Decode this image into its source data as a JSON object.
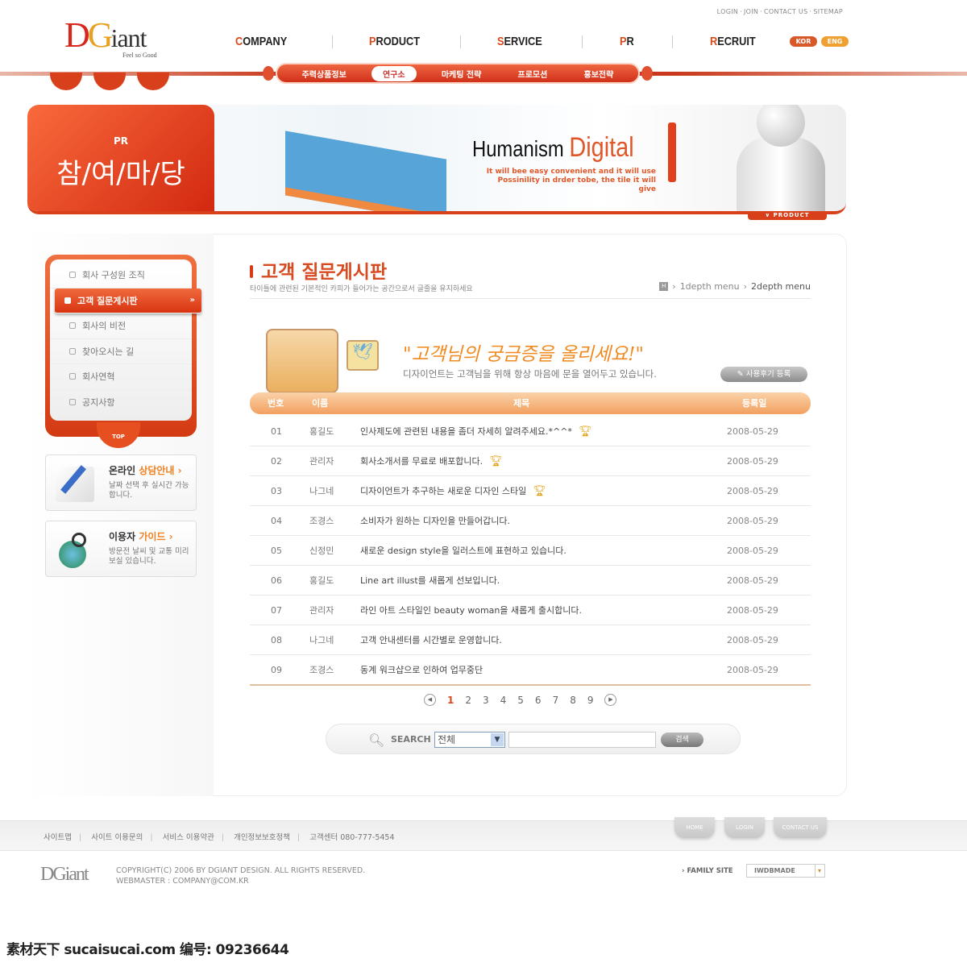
{
  "header": {
    "top_links": [
      "LOGIN",
      "JOIN",
      "CONTACT US",
      "SITEMAP"
    ],
    "logo": {
      "d": "D",
      "g": "G",
      "rest": "iant",
      "tagline": "Feel so Good"
    },
    "nav": [
      {
        "first": "C",
        "rest": "OMPANY"
      },
      {
        "first": "P",
        "rest": "RODUCT"
      },
      {
        "first": "S",
        "rest": "ERVICE"
      },
      {
        "first": "P",
        "rest": "R"
      },
      {
        "first": "R",
        "rest": "ECRUIT"
      }
    ],
    "lang": [
      "KOR",
      "ENG"
    ],
    "subnav": [
      "주력상품정보",
      "연구소",
      "마케팅 전략",
      "프로모션",
      "홍보전략"
    ],
    "subnav_active": 1
  },
  "banner": {
    "section": "PR",
    "title": "참/여/마/당",
    "headline_a": "Humanism",
    "headline_b": "Digital",
    "sub1": "It will bee easy convenient and it will use",
    "sub2": "Possinility in drder tobe, the tile it will give",
    "tag": "∨ PRODUCT"
  },
  "sidebar": {
    "menu": [
      "회사 구성원 조직",
      "고객 질문게시판",
      "회사의 비전",
      "찾아오시는 길",
      "회사연혁",
      "공지사항"
    ],
    "active": 1,
    "top": "TOP",
    "boxes": [
      {
        "title_a": "온라인 ",
        "title_b": "상담안내 ›",
        "desc": "날짜 선택 후 실시간 가능합니다."
      },
      {
        "title_a": "이용자 ",
        "title_b": "가이드 ›",
        "desc": "방문전 날씨 및 교통 미리보실 있습니다."
      }
    ]
  },
  "main": {
    "title": "고객 질문게시판",
    "desc": "타이틀에 관련된 기본적인 카피가 들어가는 공간으로서 글줄을 유지하세요",
    "breadcrumb": [
      "H",
      "1depth menu",
      "2depth menu"
    ],
    "slogan": "\"고객님의 궁금증을 올리세요!\"",
    "slogan_sub": "디자이언트는 고객님을 위해 항상 마음에 문을 열어두고 있습니다.",
    "register_button": "사용후기 등록",
    "columns": [
      "번호",
      "이름",
      "제목",
      "등록일"
    ],
    "rows": [
      {
        "no": "01",
        "name": "홍길도",
        "title": "인사제도에 관련된 내용을 좀더 자세히 알려주세요.*^^*",
        "date": "2008-05-29",
        "trophy": true
      },
      {
        "no": "02",
        "name": "관리자",
        "title": "회사소개서를 무료로 배포합니다.",
        "date": "2008-05-29",
        "trophy": true
      },
      {
        "no": "03",
        "name": "나그네",
        "title": "디자이언트가 추구하는 새로운 디자인 스타일",
        "date": "2008-05-29",
        "trophy": true
      },
      {
        "no": "04",
        "name": "조경스",
        "title": "소비자가 원하는 디자인을 만들어갑니다.",
        "date": "2008-05-29",
        "trophy": false
      },
      {
        "no": "05",
        "name": "신정민",
        "title": "새로운 design style을 일러스트에 표현하고 있습니다.",
        "date": "2008-05-29",
        "trophy": false
      },
      {
        "no": "06",
        "name": "홍길도",
        "title": "Line art illust를 새롭게 선보입니다.",
        "date": "2008-05-29",
        "trophy": false
      },
      {
        "no": "07",
        "name": "관리자",
        "title": "라인 아트 스타일인 beauty woman을 새롭게 출시합니다.",
        "date": "2008-05-29",
        "trophy": false
      },
      {
        "no": "08",
        "name": "나그네",
        "title": "고객 안내센터를 시간별로 운영합니다.",
        "date": "2008-05-29",
        "trophy": false
      },
      {
        "no": "09",
        "name": "조경스",
        "title": "동계 워크샵으로 인하여 업무중단",
        "date": "2008-05-29",
        "trophy": false
      }
    ],
    "pages": [
      "1",
      "2",
      "3",
      "4",
      "5",
      "6",
      "7",
      "8",
      "9"
    ],
    "current_page": "1",
    "search": {
      "label": "SEARCH",
      "select_value": "전체",
      "input_value": "",
      "button": "검색"
    }
  },
  "footer": {
    "links": [
      "사이트맵",
      "사이트 이용문의",
      "서비스 이용약관",
      "개인정보보호정책",
      "고객센터 080-777-5454"
    ],
    "buttons": [
      "HOME",
      "LOGIN",
      "CONTACT US"
    ],
    "logo": "DGiant",
    "copyright": "COPYRIGHT(C) 2006 BY DGIANT DESIGN. ALL RIGHTS RESERVED.",
    "webmaster": "WEBMASTER : COMPANY@COM.KR",
    "family_label": "› FAMILY SITE",
    "family_value": "IWDBMADE"
  },
  "watermark": "素材天下 sucaisucai.com  编号: 09236644",
  "colors": {
    "accent": "#d8401c",
    "orange": "#f08a20",
    "table_header": "#f2a060"
  }
}
